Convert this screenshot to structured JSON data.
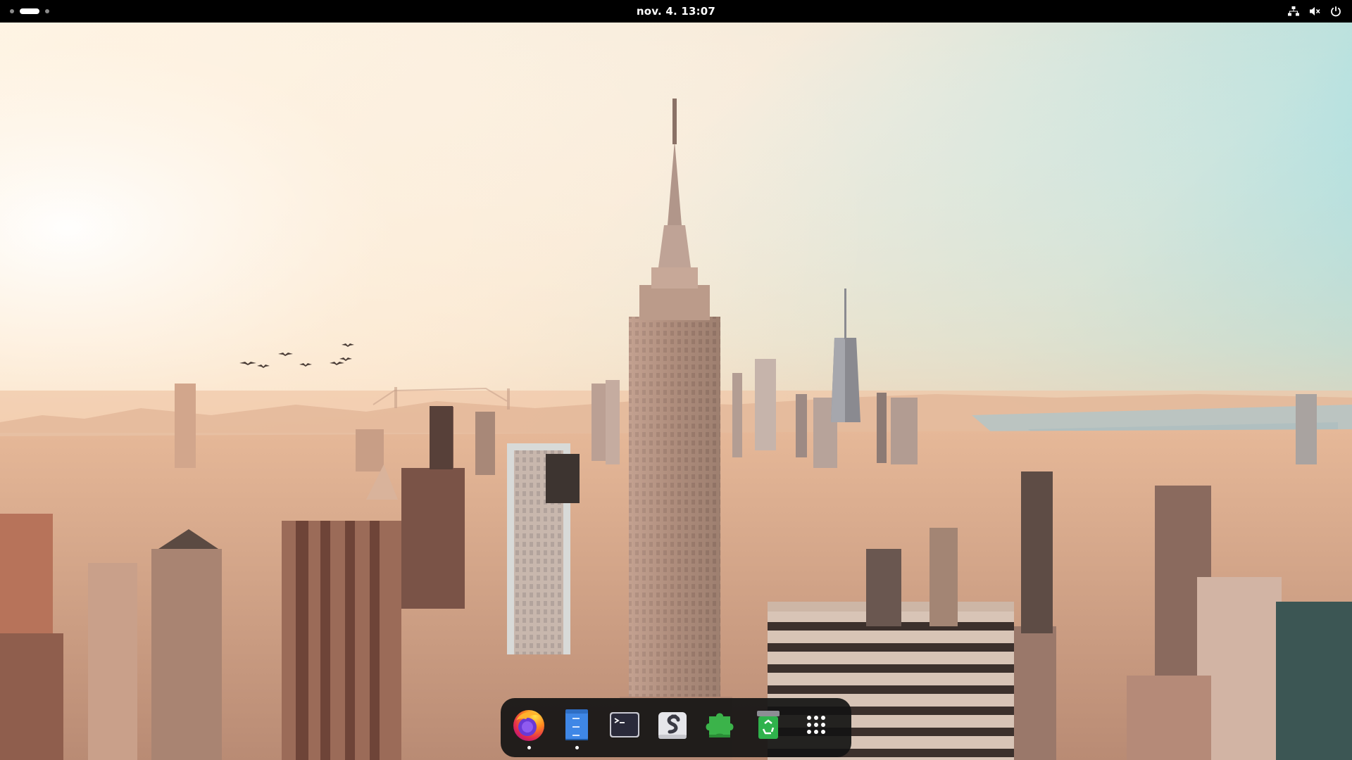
{
  "topbar": {
    "clock": "nov. 4.  13:07",
    "workspaces": {
      "count": 3,
      "active_index": 1
    },
    "tray": {
      "icons": [
        "network-wired-icon",
        "volume-muted-icon",
        "power-icon"
      ]
    }
  },
  "dock": {
    "items": [
      {
        "name": "firefox-icon",
        "running": true
      },
      {
        "name": "text-editor-icon",
        "running": true
      },
      {
        "name": "terminal-icon",
        "running": false
      },
      {
        "name": "software-center-icon",
        "running": false
      },
      {
        "name": "extensions-icon",
        "running": false
      },
      {
        "name": "trash-icon",
        "running": false
      },
      {
        "name": "show-apps-icon",
        "running": false
      }
    ]
  },
  "colors": {
    "topbar_bg": "#000000",
    "dock_bg": "#141414",
    "sky_top": "#6fd0df",
    "sky_glow": "#fbe7cf",
    "haze": "#f4c9a6"
  }
}
